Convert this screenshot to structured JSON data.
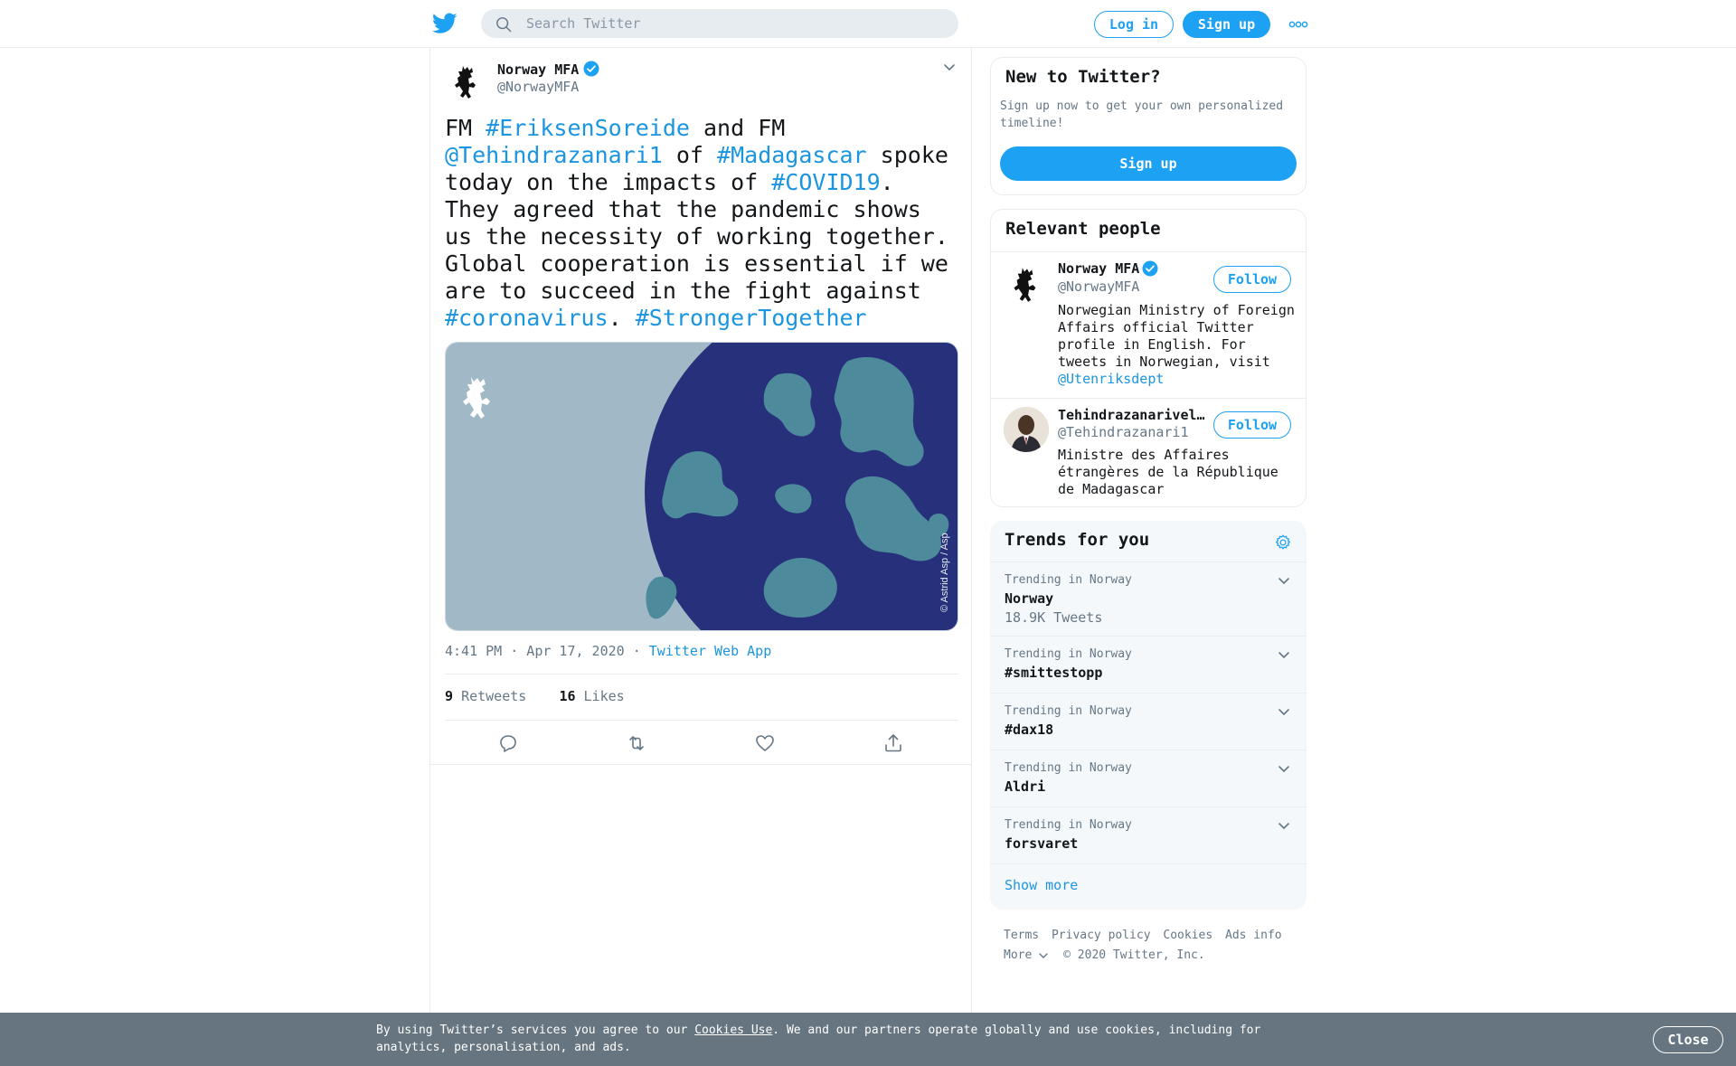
{
  "header": {
    "search_placeholder": "Search Twitter",
    "login_label": "Log in",
    "signup_label": "Sign up",
    "logo_icon": "twitter-bird-icon",
    "more_icon": "more-dots-icon",
    "accent_color": "#1da1f2"
  },
  "tweet": {
    "author_name": "Norway MFA",
    "author_handle": "@NorwayMFA",
    "text_parts": [
      {
        "text": "FM ",
        "link": false
      },
      {
        "text": "#EriksenSoreide",
        "link": true
      },
      {
        "text": " and FM ",
        "link": false
      },
      {
        "text": "@Tehindrazanari1",
        "link": true
      },
      {
        "text": " of ",
        "link": false
      },
      {
        "text": "#Madagascar",
        "link": true
      },
      {
        "text": " spoke today on the impacts of ",
        "link": false
      },
      {
        "text": "#COVID19",
        "link": true
      },
      {
        "text": ". They agreed that the pandemic shows us the necessity of working together. Global cooperation is essential if we are to succeed in the fight against ",
        "link": false
      },
      {
        "text": "#coronavirus",
        "link": true
      },
      {
        "text": ". ",
        "link": false
      },
      {
        "text": "#StrongerTogether",
        "link": true
      }
    ],
    "image_credit": "© Astrid Asp / Asp",
    "time": "4:41 PM · Apr 17, 2020",
    "separator": "·",
    "source": "Twitter Web App",
    "retweets_count": "9",
    "retweets_label": "Retweets",
    "likes_count": "16",
    "likes_label": "Likes"
  },
  "sidebar": {
    "new_to_twitter": {
      "title": "New to Twitter?",
      "subtitle": "Sign up now to get your own personalized timeline!",
      "signup_label": "Sign up"
    },
    "relevant_people": {
      "title": "Relevant people",
      "people": [
        {
          "name": "Norway MFA",
          "handle": "@NorwayMFA",
          "follow_label": "Follow",
          "bio": "Norwegian Ministry of Foreign Affairs official Twitter profile in English. For tweets in Norwegian, visit ",
          "bio_link": "@Utenriksdept"
        },
        {
          "name": "Tehindrazanarivelo Djacoba",
          "handle": "@Tehindrazanari1",
          "follow_label": "Follow",
          "bio": "Ministre des Affaires étrangères de la République de Madagascar"
        }
      ]
    },
    "trends": {
      "title": "Trends for you",
      "items": [
        {
          "context": "Trending in Norway",
          "name": "Norway",
          "count": "18.9K Tweets"
        },
        {
          "context": "Trending in Norway",
          "name": "#smittestopp"
        },
        {
          "context": "Trending in Norway",
          "name": "#dax18"
        },
        {
          "context": "Trending in Norway",
          "name": "Aldri"
        },
        {
          "context": "Trending in Norway",
          "name": "forsvaret"
        }
      ],
      "show_more": "Show more"
    },
    "footer": {
      "links": [
        "Terms",
        "Privacy policy",
        "Cookies",
        "Ads info"
      ],
      "more": "More",
      "copyright": "© 2020 Twitter, Inc."
    }
  },
  "cookie_bar": {
    "text_before": "By using Twitter’s services you agree to our ",
    "link": "Cookies Use",
    "text_after": ". We and our partners operate globally and use cookies, including for analytics, personalisation, and ads.",
    "close_label": "Close"
  }
}
